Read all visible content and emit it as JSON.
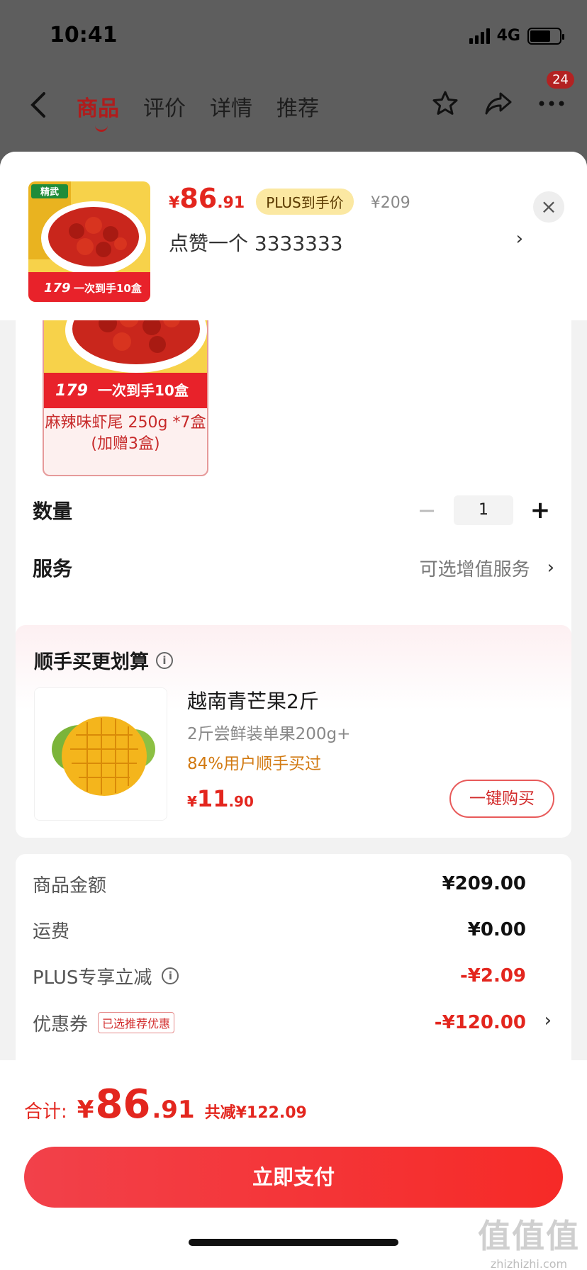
{
  "status_bar": {
    "time": "10:41",
    "network": "4G",
    "battery_level": 0.7
  },
  "nav": {
    "tabs": [
      "商品",
      "评价",
      "详情",
      "推荐"
    ],
    "active_tab": "商品",
    "badge_count": "24"
  },
  "product": {
    "price_symbol": "¥",
    "price_int": "86",
    "price_dec": ".91",
    "plus_tag": "PLUS到手价",
    "original_price": "¥209",
    "like_text": "点赞一个 3333333",
    "like_arrow": "›",
    "close": "×",
    "image_badge": "精武",
    "image_price": "179",
    "image_promo": "一次到手10盒"
  },
  "variant": {
    "label": "麻辣味虾尾 250g *7盒 (加赠3盒)",
    "image_price": "179",
    "image_promo": "一次到手10盒"
  },
  "options": {
    "quantity_label": "数量",
    "quantity_minus": "−",
    "quantity_value": "1",
    "quantity_plus": "+",
    "service_label": "服务",
    "service_value": "可选增值服务",
    "service_chevron": "›"
  },
  "recommend": {
    "title": "顺手买更划算",
    "info": "i",
    "name": "越南青芒果2斤",
    "subtitle": "2斤尝鲜装单果200g+",
    "buy_rate": "84%用户顺手买过",
    "price_symbol": "¥",
    "price_int": "11",
    "price_dec": ".90",
    "buy_button": "一键购买"
  },
  "summary": {
    "rows": [
      {
        "label": "商品金额",
        "value": "¥209.00"
      },
      {
        "label": "运费",
        "value": "¥0.00"
      },
      {
        "label": "PLUS专享立减",
        "value": "-¥2.09"
      },
      {
        "label": "优惠券",
        "tag": "已选推荐优惠",
        "value": "-¥120.00"
      }
    ],
    "chevron": "›"
  },
  "footer": {
    "total_label": "合计:",
    "total_symbol": "¥",
    "total_int": "86",
    "total_dec": ".91",
    "total_saving": "共减¥122.09",
    "pay_button": "立即支付",
    "watermark_top": "值值值",
    "watermark_bottom": "zhizhizhi.com"
  },
  "colors": {
    "accent_red": "#e3261e",
    "plus_gold": "#fbe8a2",
    "orange_text": "#d27a12"
  }
}
